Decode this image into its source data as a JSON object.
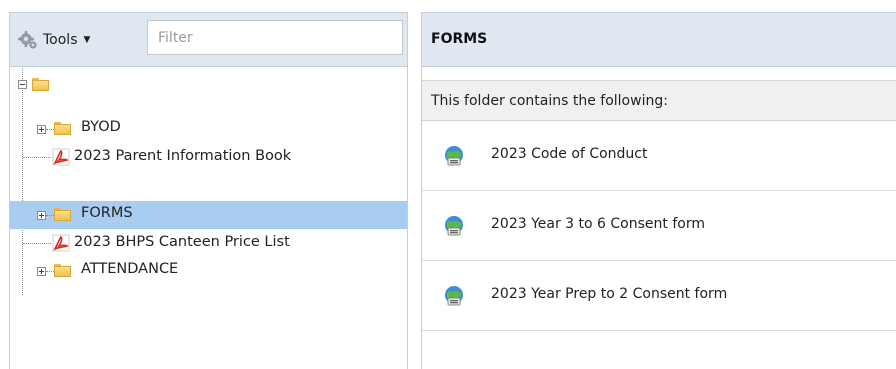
{
  "toolbar": {
    "tools_label": "Tools",
    "filter_placeholder": "Filter"
  },
  "tree": {
    "items": [
      {
        "label": "BYOD",
        "type": "folder",
        "icon": "folder-icon",
        "expandable": true
      },
      {
        "label": "2023 Parent Information Book",
        "type": "pdf",
        "icon": "pdf-icon"
      },
      {
        "label": "FORMS",
        "type": "folder",
        "icon": "folder-icon",
        "expandable": true,
        "selected": true
      },
      {
        "label": "2023 BHPS Canteen Price List",
        "type": "pdf",
        "icon": "pdf-icon"
      },
      {
        "label": "ATTENDANCE",
        "type": "folder",
        "icon": "folder-icon",
        "expandable": true
      }
    ]
  },
  "detail": {
    "title": "FORMS",
    "contents_heading": "This folder contains the following:",
    "items": [
      {
        "label": "2023 Code of Conduct",
        "icon": "web-form-icon"
      },
      {
        "label": "2023 Year 3 to 6 Consent form",
        "icon": "web-form-icon"
      },
      {
        "label": "2023 Year Prep to 2 Consent form",
        "icon": "web-form-icon"
      }
    ]
  },
  "colors": {
    "header_bg": "#dfe8f1",
    "selected_row": "#a8cdf0",
    "border": "#c5cfd9"
  }
}
